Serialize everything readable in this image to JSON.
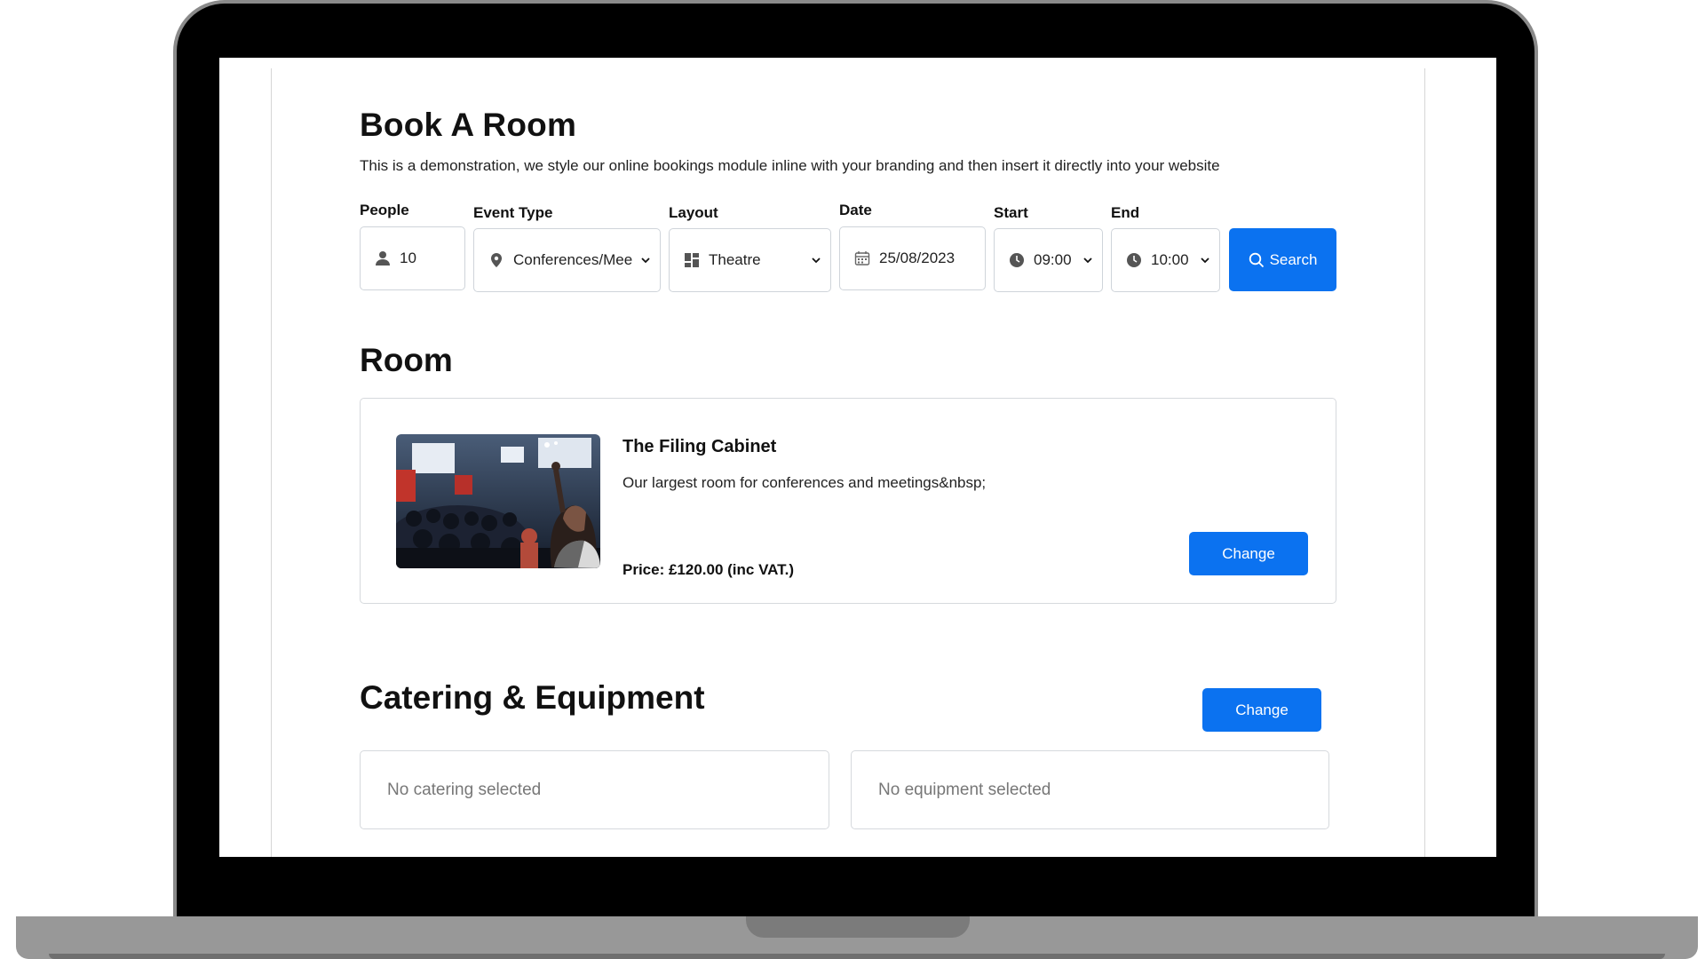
{
  "page": {
    "title": "Book A Room",
    "subtitle": "This is a demonstration, we style our online bookings module inline with your branding and then insert it directly into your website"
  },
  "search": {
    "people": {
      "label": "People",
      "value": "10",
      "icon": "person-icon"
    },
    "event_type": {
      "label": "Event Type",
      "value": "Conferences/Mee",
      "icon": "map-pin-icon"
    },
    "layout": {
      "label": "Layout",
      "value": "Theatre",
      "icon": "layout-grid-icon"
    },
    "date": {
      "label": "Date",
      "value": "25/08/2023",
      "icon": "calendar-icon"
    },
    "start": {
      "label": "Start",
      "value": "09:00",
      "icon": "clock-icon"
    },
    "end": {
      "label": "End",
      "value": "10:00",
      "icon": "clock-icon"
    },
    "button_label": "Search"
  },
  "room": {
    "section_title": "Room",
    "name": "The Filing Cabinet",
    "description": "Our largest room for conferences and meetings&nbsp;",
    "price": "Price: £120.00 (inc VAT.)",
    "change_label": "Change"
  },
  "catering": {
    "section_title": "Catering & Equipment",
    "change_label": "Change",
    "catering_empty": "No catering selected",
    "equipment_empty": "No equipment selected"
  },
  "colors": {
    "accent": "#0b72f0",
    "border": "#d6d9dd"
  }
}
